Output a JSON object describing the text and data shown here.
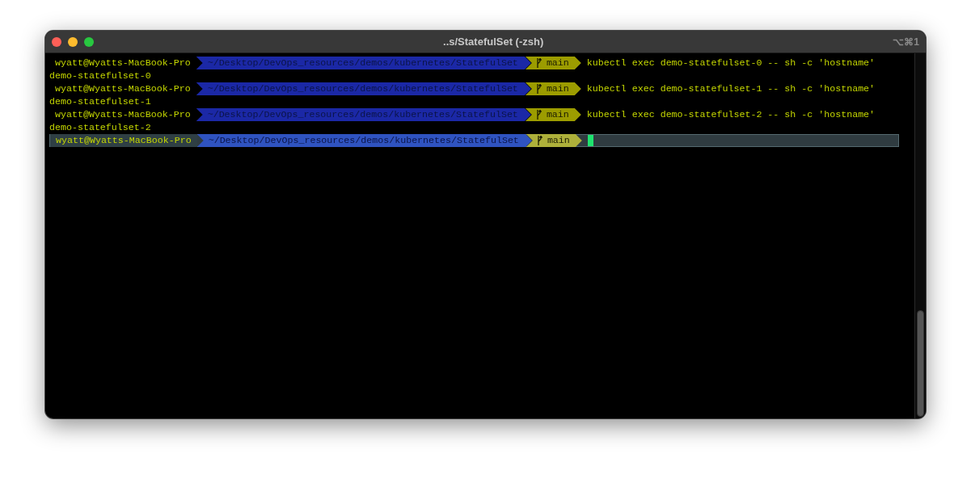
{
  "window": {
    "title": "..s/StatefulSet (-zsh)",
    "shortcut": "⌥⌘1"
  },
  "lines": [
    {
      "kind": "prompt",
      "user": "wyatt@Wyatts-MacBook-Pro",
      "path": "~/Desktop/DevOps_resources/demos/kubernetes/StatefulSet",
      "branch": "main",
      "command": "kubectl exec demo-statefulset-0 -- sh -c 'hostname'",
      "active": false
    },
    {
      "kind": "output",
      "text": "demo-statefulset-0"
    },
    {
      "kind": "prompt",
      "user": "wyatt@Wyatts-MacBook-Pro",
      "path": "~/Desktop/DevOps_resources/demos/kubernetes/StatefulSet",
      "branch": "main",
      "command": "kubectl exec demo-statefulset-1 -- sh -c 'hostname'",
      "active": false
    },
    {
      "kind": "output",
      "text": "demo-statefulset-1"
    },
    {
      "kind": "prompt",
      "user": "wyatt@Wyatts-MacBook-Pro",
      "path": "~/Desktop/DevOps_resources/demos/kubernetes/StatefulSet",
      "branch": "main",
      "command": "kubectl exec demo-statefulset-2 -- sh -c 'hostname'",
      "active": false
    },
    {
      "kind": "output",
      "text": "demo-statefulset-2"
    },
    {
      "kind": "prompt",
      "user": "wyatt@Wyatts-MacBook-Pro",
      "path": "~/Desktop/DevOps_resources/demos/kubernetes/StatefulSet",
      "branch": "main",
      "active": true
    }
  ]
}
